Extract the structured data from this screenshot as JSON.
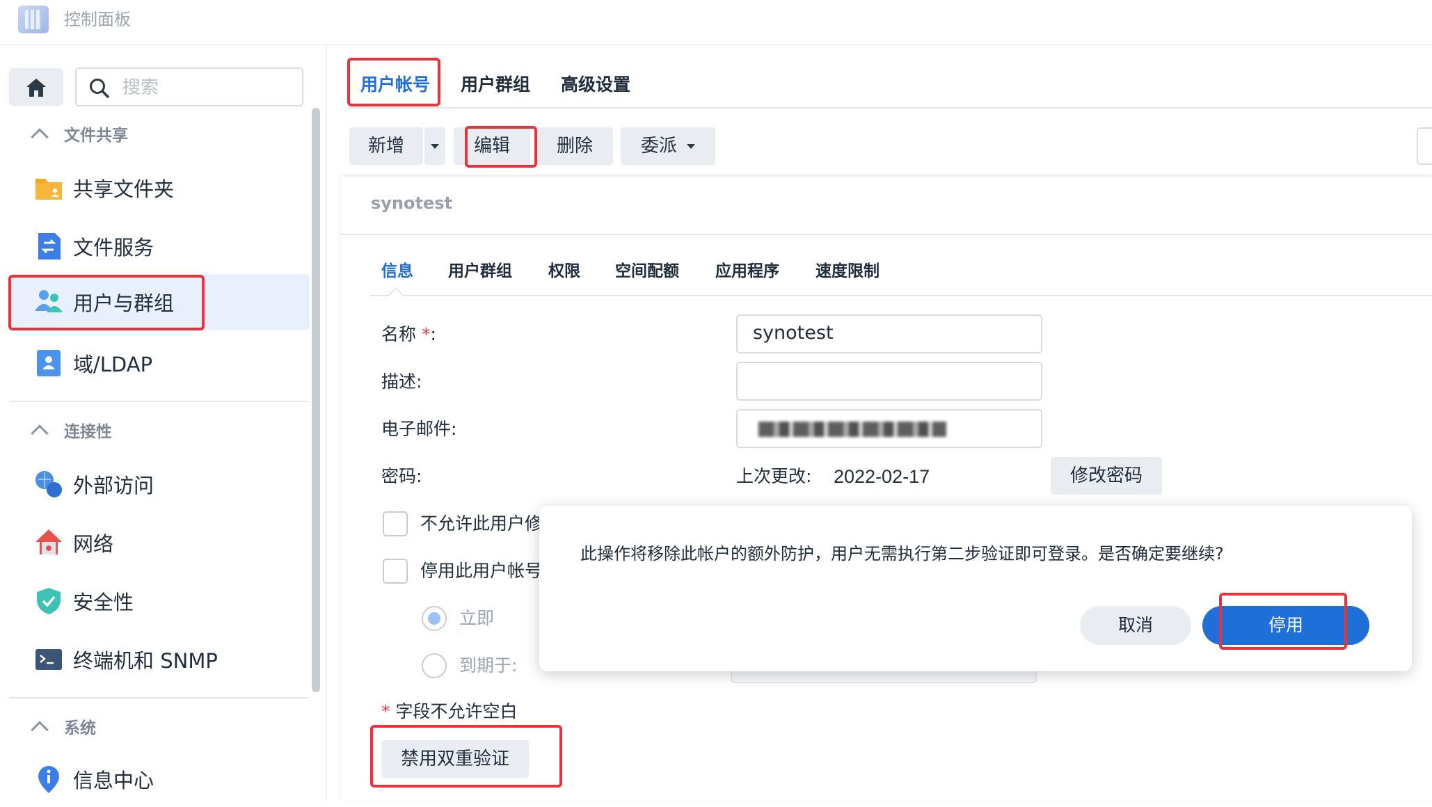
{
  "window": {
    "title": "控制面板"
  },
  "sidebar": {
    "search_placeholder": "搜索",
    "sections": [
      {
        "title": "文件共享",
        "items": [
          {
            "label": "共享文件夹",
            "icon": "shared-folder-icon"
          },
          {
            "label": "文件服务",
            "icon": "file-services-icon"
          },
          {
            "label": "用户与群组",
            "icon": "users-groups-icon",
            "active": true
          },
          {
            "label": "域/LDAP",
            "icon": "domain-ldap-icon"
          }
        ]
      },
      {
        "title": "连接性",
        "items": [
          {
            "label": "外部访问",
            "icon": "external-access-icon"
          },
          {
            "label": "网络",
            "icon": "network-icon"
          },
          {
            "label": "安全性",
            "icon": "security-icon"
          },
          {
            "label": "终端机和 SNMP",
            "icon": "terminal-icon"
          }
        ]
      },
      {
        "title": "系统",
        "items": [
          {
            "label": "信息中心",
            "icon": "info-center-icon"
          }
        ]
      }
    ]
  },
  "main": {
    "tabs": [
      "用户帐号",
      "用户群组",
      "高级设置"
    ],
    "active_tab": "用户帐号",
    "toolbar": {
      "add": "新增",
      "edit": "编辑",
      "delete": "删除",
      "delegate": "委派"
    }
  },
  "panel": {
    "title": "synotest",
    "tabs": [
      "信息",
      "用户群组",
      "权限",
      "空间配额",
      "应用程序",
      "速度限制"
    ],
    "active_tab": "信息",
    "fields": {
      "name_label": "名称",
      "required_mark": "*",
      "colon": ":",
      "name_value": "synotest",
      "description_label": "描述:",
      "description_value": "",
      "email_label": "电子邮件:",
      "password_label": "密码:",
      "last_changed_label": "上次更改:",
      "last_changed_value": "2022-02-17",
      "change_password": "修改密码"
    },
    "options": {
      "disallow_change": "不允许此用户修",
      "disable_account": "停用此用户帐号",
      "immediately": "立即",
      "expire_on": "到期于:"
    },
    "required_note_mark": "*",
    "required_note": "字段不允许空白",
    "disable_2fa": "禁用双重验证"
  },
  "dialog": {
    "message": "此操作将移除此帐户的额外防护，用户无需执行第二步验证即可登录。是否确定要继续?",
    "cancel": "取消",
    "confirm": "停用"
  },
  "colors": {
    "accent": "#1e6fd9",
    "highlight": "#e8333d",
    "confirm_button": "#1f6fd8"
  }
}
